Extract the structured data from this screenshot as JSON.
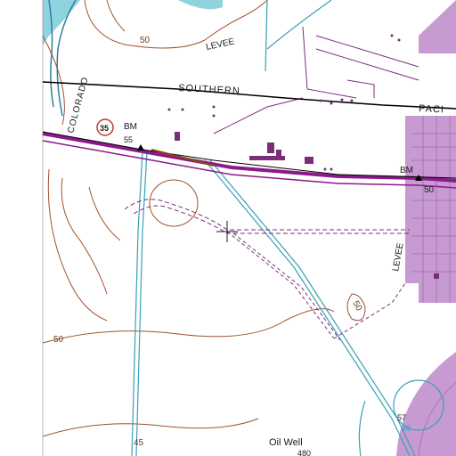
{
  "map": {
    "labels": {
      "levee_top": "LEVEE",
      "southern": "SOUTHERN",
      "pacific": "PACI",
      "colorado": "COLORADO",
      "levee_right": "LEVEE",
      "bm_left": "BM",
      "bm_left_value": "55",
      "bm_right": "BM",
      "bm_right_value": "50",
      "route_shield": "35",
      "contour_50_top": "50",
      "contour_50_left": "50",
      "contour_50_right": "50",
      "contour_45": "45",
      "elev_57": "57",
      "elev_46": "46",
      "oil_well": "Oil Well",
      "oil_well_elev": "480"
    },
    "colors": {
      "water": "#8fd3df",
      "river_bank": "#2d7fa0",
      "contour": "#a0522d",
      "railroad": "#000000",
      "highway": "#8b1a8b",
      "urban": "#b07abf",
      "road": "#7a2e7a",
      "canal": "#3aa0b8"
    }
  }
}
